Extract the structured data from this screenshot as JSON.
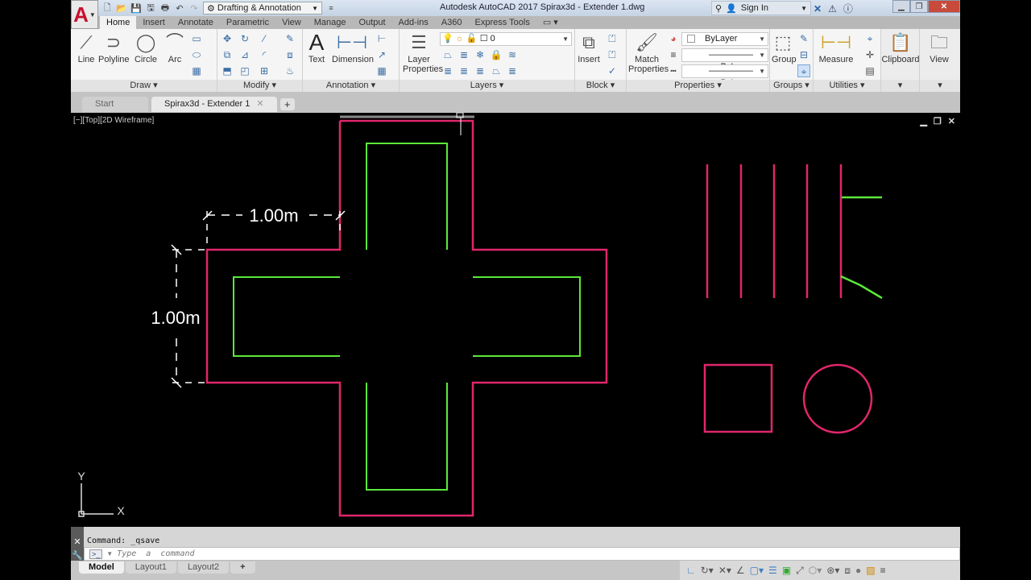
{
  "titlebar": {
    "app_logo": "A",
    "workspace": "Drafting & Annotation",
    "title": "Autodesk AutoCAD 2017    Spirax3d - Extender 1.dwg",
    "sign_in": "Sign In",
    "qat_icons": [
      "new-icon",
      "open-icon",
      "save-icon",
      "save-as-icon",
      "plot-icon",
      "undo-icon",
      "redo-icon"
    ]
  },
  "ribbon_tabs": [
    "Home",
    "Insert",
    "Annotate",
    "Parametric",
    "View",
    "Manage",
    "Output",
    "Add-ins",
    "A360",
    "Express Tools"
  ],
  "active_ribbon_tab": "Home",
  "panels": {
    "draw": {
      "title": "Draw",
      "line": "Line",
      "polyline": "Polyline",
      "circle": "Circle",
      "arc": "Arc"
    },
    "modify": {
      "title": "Modify"
    },
    "annotation": {
      "title": "Annotation",
      "text": "Text",
      "dimension": "Dimension"
    },
    "layers": {
      "title": "Layers",
      "layer_properties_1": "Layer",
      "layer_properties_2": "Properties",
      "current_layer": "0"
    },
    "block": {
      "title": "Block",
      "insert": "Insert"
    },
    "properties": {
      "title": "Properties",
      "match_1": "Match",
      "match_2": "Properties",
      "color": "ByLayer",
      "linetype": "ByLayer",
      "lineweight": "ByLayer"
    },
    "groups": {
      "title": "Groups",
      "group": "Group"
    },
    "utilities": {
      "title": "Utilities",
      "measure": "Measure"
    },
    "clipboard": {
      "title": "Clipboard"
    },
    "view": {
      "title": "View"
    }
  },
  "file_tabs": [
    {
      "label": "Start",
      "active": false
    },
    {
      "label": "Spirax3d - Extender 1",
      "active": true
    }
  ],
  "viewport": {
    "label": "[−][Top][2D Wireframe]",
    "dim_horizontal": "1.00m",
    "dim_vertical": "1.00m",
    "ucs_x": "X",
    "ucs_y": "Y",
    "colors": {
      "outline": "#e0266b",
      "inner": "#5be83a",
      "dimension": "#ffffff"
    }
  },
  "command": {
    "history": "Command:  _qsave",
    "placeholder": "Type  a  command"
  },
  "layout_tabs": [
    {
      "label": "Model",
      "active": true
    },
    {
      "label": "Layout1",
      "active": false
    },
    {
      "label": "Layout2",
      "active": false
    }
  ],
  "status_icons": [
    "ortho-icon",
    "polar-icon",
    "osnap-tracking-icon",
    "angle-icon",
    "osnap-icon",
    "lineweight-icon",
    "transparency-icon",
    "annotation-scale-icon",
    "3d-icon",
    "gizmo-icon",
    "isolate-icon",
    "hardware-icon",
    "clean-screen-icon",
    "menu-icon"
  ]
}
